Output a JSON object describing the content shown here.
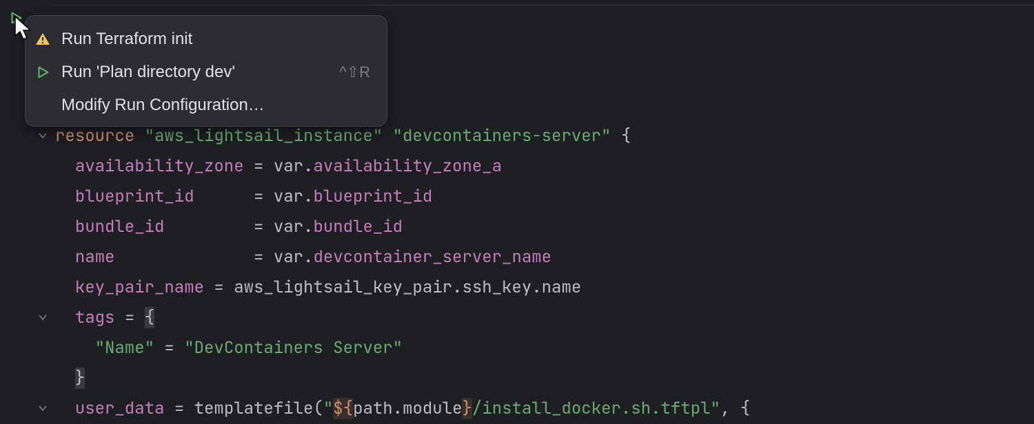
{
  "context_menu": {
    "items": [
      {
        "icon": "warning-icon",
        "label": "Run Terraform init",
        "shortcut": ""
      },
      {
        "icon": "run-icon",
        "label": "Run 'Plan directory dev'",
        "shortcut": "^⇧R"
      },
      {
        "icon": "none",
        "label": "Modify Run Configuration…",
        "shortcut": ""
      }
    ]
  },
  "code": {
    "lines": [
      {
        "indent": 0,
        "fold": false,
        "tokens": []
      },
      {
        "indent": 0,
        "fold": false,
        "tokens": []
      },
      {
        "indent": 0,
        "fold": false,
        "tokens": []
      },
      {
        "indent": 0,
        "fold": false,
        "tokens": []
      },
      {
        "indent": 0,
        "fold": true,
        "tokens": [
          {
            "cls": "kw",
            "t": "resource"
          },
          {
            "cls": "pn",
            "t": " "
          },
          {
            "cls": "str",
            "t": "\"aws_lightsail_instance\""
          },
          {
            "cls": "pn",
            "t": " "
          },
          {
            "cls": "str",
            "t": "\"devcontainers-server\""
          },
          {
            "cls": "pn",
            "t": " {"
          }
        ]
      },
      {
        "indent": 1,
        "fold": false,
        "tokens": [
          {
            "cls": "attr",
            "t": "availability_zone"
          },
          {
            "cls": "pn",
            "t": " "
          },
          {
            "cls": "op",
            "t": "="
          },
          {
            "cls": "pn",
            "t": " var"
          },
          {
            "cls": "op",
            "t": "."
          },
          {
            "cls": "attr",
            "t": "availability_zone_a"
          }
        ]
      },
      {
        "indent": 1,
        "fold": false,
        "tokens": [
          {
            "cls": "attr",
            "t": "blueprint_id"
          },
          {
            "cls": "pn",
            "t": "      "
          },
          {
            "cls": "op",
            "t": "="
          },
          {
            "cls": "pn",
            "t": " var"
          },
          {
            "cls": "op",
            "t": "."
          },
          {
            "cls": "attr",
            "t": "blueprint_id"
          }
        ]
      },
      {
        "indent": 1,
        "fold": false,
        "tokens": [
          {
            "cls": "attr",
            "t": "bundle_id"
          },
          {
            "cls": "pn",
            "t": "         "
          },
          {
            "cls": "op",
            "t": "="
          },
          {
            "cls": "pn",
            "t": " var"
          },
          {
            "cls": "op",
            "t": "."
          },
          {
            "cls": "attr",
            "t": "bundle_id"
          }
        ]
      },
      {
        "indent": 1,
        "fold": false,
        "tokens": [
          {
            "cls": "attr",
            "t": "name"
          },
          {
            "cls": "pn",
            "t": "              "
          },
          {
            "cls": "op",
            "t": "="
          },
          {
            "cls": "pn",
            "t": " var"
          },
          {
            "cls": "op",
            "t": "."
          },
          {
            "cls": "attr",
            "t": "devcontainer_server_name"
          }
        ]
      },
      {
        "indent": 1,
        "fold": false,
        "tokens": [
          {
            "cls": "attr",
            "t": "key_pair_name"
          },
          {
            "cls": "pn",
            "t": " "
          },
          {
            "cls": "op",
            "t": "="
          },
          {
            "cls": "pn",
            "t": " aws_lightsail_key_pair"
          },
          {
            "cls": "op",
            "t": "."
          },
          {
            "cls": "pn",
            "t": "ssh_key"
          },
          {
            "cls": "op",
            "t": "."
          },
          {
            "cls": "pn",
            "t": "name"
          }
        ]
      },
      {
        "indent": 1,
        "fold": true,
        "tokens": [
          {
            "cls": "attr",
            "t": "tags"
          },
          {
            "cls": "pn",
            "t": " "
          },
          {
            "cls": "op",
            "t": "="
          },
          {
            "cls": "pn",
            "t": " "
          },
          {
            "cls": "sel",
            "t": "{"
          }
        ]
      },
      {
        "indent": 2,
        "fold": false,
        "tokens": [
          {
            "cls": "str",
            "t": "\"Name\""
          },
          {
            "cls": "pn",
            "t": " "
          },
          {
            "cls": "op",
            "t": "="
          },
          {
            "cls": "pn",
            "t": " "
          },
          {
            "cls": "str",
            "t": "\"DevContainers Server\""
          }
        ]
      },
      {
        "indent": 1,
        "fold": false,
        "tokens": [
          {
            "cls": "sel",
            "t": "}"
          }
        ]
      },
      {
        "indent": 1,
        "fold": true,
        "tokens": [
          {
            "cls": "attr",
            "t": "user_data"
          },
          {
            "cls": "pn",
            "t": " "
          },
          {
            "cls": "op",
            "t": "="
          },
          {
            "cls": "pn",
            "t": " templatefile("
          },
          {
            "cls": "str",
            "t": "\""
          },
          {
            "cls": "interp",
            "t": "${"
          },
          {
            "cls": "pn",
            "t": "path"
          },
          {
            "cls": "op",
            "t": "."
          },
          {
            "cls": "pn",
            "t": "module"
          },
          {
            "cls": "interp",
            "t": "}"
          },
          {
            "cls": "str",
            "t": "/install_docker.sh.tftpl\""
          },
          {
            "cls": "pn",
            "t": ", {"
          }
        ]
      }
    ]
  }
}
